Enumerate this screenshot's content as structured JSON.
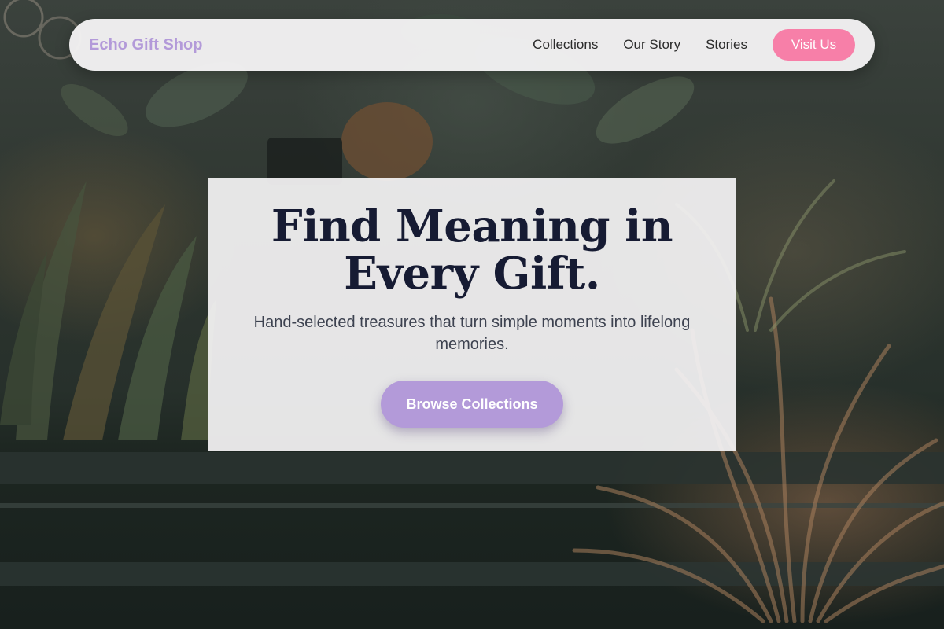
{
  "navbar": {
    "brand": "Echo Gift Shop",
    "links": [
      {
        "label": "Collections"
      },
      {
        "label": "Our Story"
      },
      {
        "label": "Stories"
      }
    ],
    "cta_label": "Visit Us"
  },
  "hero": {
    "title": "Find Meaning in Every Gift.",
    "subtitle": "Hand-selected treasures that turn simple moments into lifelong memories.",
    "button_label": "Browse Collections"
  },
  "colors": {
    "brand": "#b39ad9",
    "cta_pink": "#f77fa8",
    "title_navy": "#161b33",
    "card_bg": "#f4f3f4"
  },
  "background": {
    "icon": "plants-window-photo"
  }
}
